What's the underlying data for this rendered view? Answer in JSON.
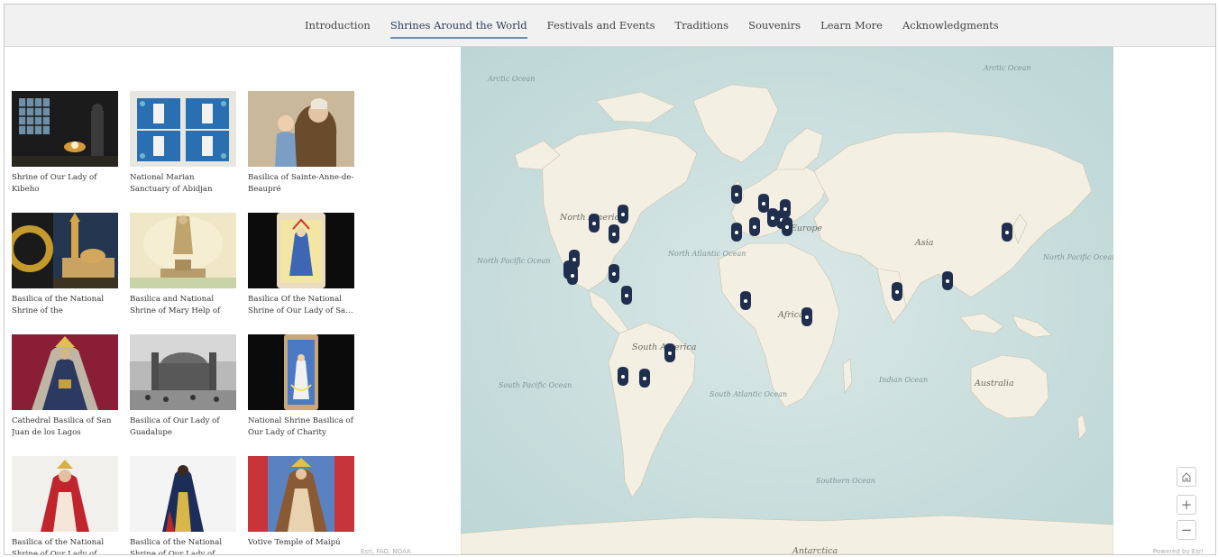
{
  "nav": {
    "items": [
      {
        "label": "Introduction"
      },
      {
        "label": "Shrines Around the World",
        "active": true
      },
      {
        "label": "Festivals and Events"
      },
      {
        "label": "Traditions"
      },
      {
        "label": "Souvenirs"
      },
      {
        "label": "Learn More"
      },
      {
        "label": "Acknowledgments"
      }
    ]
  },
  "gallery": {
    "cards": [
      {
        "title": "Shrine of Our Lady of Kibeho"
      },
      {
        "title": "National Marian Sanctuary of Abidjan"
      },
      {
        "title": "Basilica of Sainte-Anne-de-Beaupré"
      },
      {
        "title": "Basilica of the National Shrine of the Immaculate…"
      },
      {
        "title": "Basilica and National Shrine of Mary Help of Christian…"
      },
      {
        "title": "Basilica Of the National Shrine of Our Lady of Sa…"
      },
      {
        "title": "Cathedral Basilica of San Juan de los Lagos"
      },
      {
        "title": "Basilica of Our Lady of Guadalupe"
      },
      {
        "title": "National Shrine Basilica of Our Lady of Charity"
      },
      {
        "title": "Basilica of the National Shrine of Our Lady of…"
      },
      {
        "title": "Basilica of the National Shrine of Our Lady of…"
      },
      {
        "title": "Votive Temple of Maipú"
      }
    ]
  },
  "map": {
    "labels": {
      "north_america": "North America",
      "south_america": "South America",
      "europe": "Europe",
      "asia": "Asia",
      "africa": "Africa",
      "australia": "Australia",
      "antarctica": "Antarctica",
      "arctic_left": "Arctic Ocean",
      "arctic_right": "Arctic Ocean",
      "north_pacific_left": "North Pacific Ocean",
      "north_pacific_right": "North Pacific Ocean",
      "north_atlantic": "North Atlantic Ocean",
      "south_pacific": "South Pacific Ocean",
      "south_atlantic": "South Atlantic Ocean",
      "indian_ocean": "Indian Ocean",
      "southern_ocean": "Southern Ocean"
    },
    "attribution_left": "Esri, FAO, NOAA",
    "attribution_right": "Powered by Esri",
    "controls": {
      "home": "home-icon",
      "zoom_in": "+",
      "zoom_out": "−"
    },
    "pin_color": "#1f2f4d"
  },
  "colors": {
    "accent": "#6c8fb0",
    "ocean": "#cfe0df",
    "land": "#f3efe3"
  }
}
